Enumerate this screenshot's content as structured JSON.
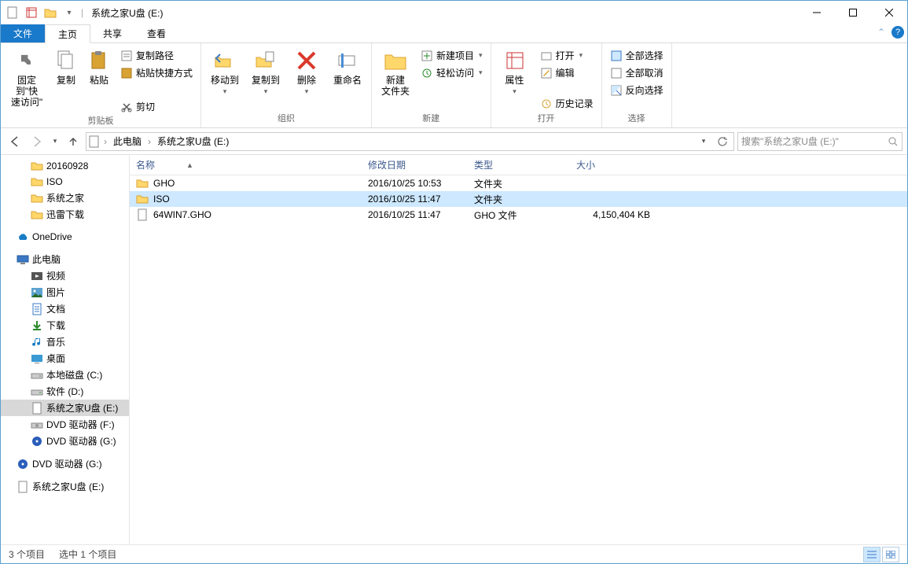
{
  "window": {
    "title": "系统之家U盘 (E:)"
  },
  "tabs": {
    "file": "文件",
    "home": "主页",
    "share": "共享",
    "view": "查看"
  },
  "ribbon": {
    "clipboard": {
      "pin": "固定到\"快\n速访问\"",
      "copy": "复制",
      "paste": "粘贴",
      "copypath": "复制路径",
      "pasteshortcut": "粘贴快捷方式",
      "cut": "剪切",
      "label": "剪贴板"
    },
    "organize": {
      "moveto": "移动到",
      "copyto": "复制到",
      "delete": "删除",
      "rename": "重命名",
      "label": "组织"
    },
    "new": {
      "newfolder": "新建\n文件夹",
      "newitem": "新建项目",
      "easyaccess": "轻松访问",
      "label": "新建"
    },
    "open": {
      "properties": "属性",
      "open": "打开",
      "edit": "编辑",
      "history": "历史记录",
      "label": "打开"
    },
    "select": {
      "selectall": "全部选择",
      "selectnone": "全部取消",
      "invert": "反向选择",
      "label": "选择"
    }
  },
  "breadcrumb": {
    "thispc": "此电脑",
    "drive": "系统之家U盘 (E:)"
  },
  "search": {
    "placeholder": "搜索\"系统之家U盘 (E:)\""
  },
  "tree": [
    {
      "label": "20160928",
      "icon": "folder",
      "indent": 38
    },
    {
      "label": "ISO",
      "icon": "folder",
      "indent": 38
    },
    {
      "label": "系统之家",
      "icon": "folder",
      "indent": 38
    },
    {
      "label": "迅雷下载",
      "icon": "folder",
      "indent": 38
    },
    {
      "label": "",
      "icon": "blank",
      "indent": 38
    },
    {
      "label": "OneDrive",
      "icon": "onedrive",
      "indent": 20
    },
    {
      "label": "",
      "icon": "blank",
      "indent": 20
    },
    {
      "label": "此电脑",
      "icon": "thispc",
      "indent": 20
    },
    {
      "label": "视频",
      "icon": "video",
      "indent": 38
    },
    {
      "label": "图片",
      "icon": "image",
      "indent": 38
    },
    {
      "label": "文档",
      "icon": "doc",
      "indent": 38
    },
    {
      "label": "下载",
      "icon": "download",
      "indent": 38
    },
    {
      "label": "音乐",
      "icon": "music",
      "indent": 38
    },
    {
      "label": "桌面",
      "icon": "desktop",
      "indent": 38
    },
    {
      "label": "本地磁盘 (C:)",
      "icon": "drive",
      "indent": 38
    },
    {
      "label": "软件 (D:)",
      "icon": "drive",
      "indent": 38
    },
    {
      "label": "系统之家U盘 (E:)",
      "icon": "file",
      "indent": 38,
      "sel": true
    },
    {
      "label": "DVD 驱动器 (F:)",
      "icon": "dvd",
      "indent": 38
    },
    {
      "label": "DVD 驱动器 (G:)",
      "icon": "dvdblue",
      "indent": 38
    },
    {
      "label": "",
      "icon": "blank",
      "indent": 20
    },
    {
      "label": "DVD 驱动器 (G:)",
      "icon": "dvdblue",
      "indent": 20
    },
    {
      "label": "",
      "icon": "blank",
      "indent": 20
    },
    {
      "label": "系统之家U盘 (E:)",
      "icon": "file",
      "indent": 20
    }
  ],
  "columns": {
    "name": "名称",
    "date": "修改日期",
    "type": "类型",
    "size": "大小"
  },
  "files": [
    {
      "name": "GHO",
      "date": "2016/10/25 10:53",
      "type": "文件夹",
      "size": "",
      "icon": "folder"
    },
    {
      "name": "ISO",
      "date": "2016/10/25 11:47",
      "type": "文件夹",
      "size": "",
      "icon": "folder",
      "selected": true
    },
    {
      "name": "64WIN7.GHO",
      "date": "2016/10/25 11:47",
      "type": "GHO 文件",
      "size": "4,150,404 KB",
      "icon": "file"
    }
  ],
  "status": {
    "count": "3 个项目",
    "selected": "选中 1 个项目"
  }
}
